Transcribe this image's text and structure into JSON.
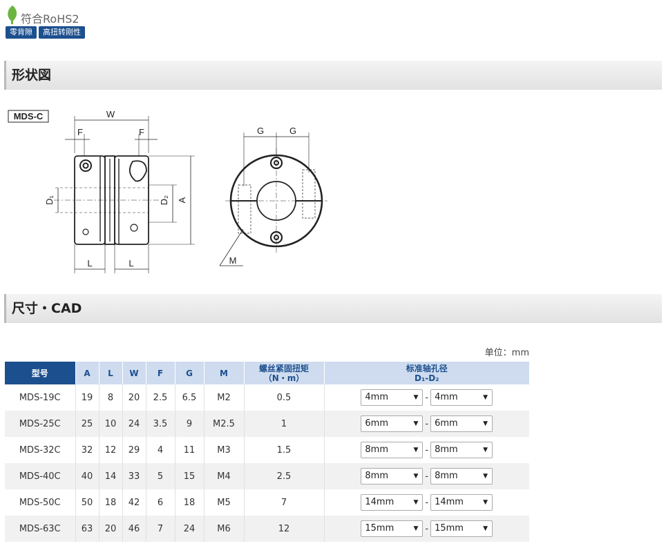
{
  "badges": {
    "rohs": "符合RoHS2",
    "tags": [
      "零背隙",
      "高扭转刚性"
    ]
  },
  "sections": {
    "shape": "形状図",
    "dimensions": "尺寸・CAD"
  },
  "drawing": {
    "model_label": "MDS-C",
    "labels": {
      "W": "W",
      "F": "F",
      "G": "G",
      "A": "A",
      "L": "L",
      "M": "M",
      "D1": "D₁",
      "D2": "D₂"
    }
  },
  "table": {
    "unit": "单位：mm",
    "headers": {
      "model": "型号",
      "A": "A",
      "L": "L",
      "W": "W",
      "F": "F",
      "G": "G",
      "M": "M",
      "torque_line1": "螺丝紧固扭矩",
      "torque_line2": "（N・m）",
      "bore_line1": "标准轴孔径",
      "bore_line2": "D₁-D₂"
    },
    "rows": [
      {
        "model": "MDS-19C",
        "A": "19",
        "L": "8",
        "W": "20",
        "F": "2.5",
        "G": "6.5",
        "M": "M2",
        "torque": "0.5",
        "d1": "4mm",
        "d2": "4mm"
      },
      {
        "model": "MDS-25C",
        "A": "25",
        "L": "10",
        "W": "24",
        "F": "3.5",
        "G": "9",
        "M": "M2.5",
        "torque": "1",
        "d1": "6mm",
        "d2": "6mm"
      },
      {
        "model": "MDS-32C",
        "A": "32",
        "L": "12",
        "W": "29",
        "F": "4",
        "G": "11",
        "M": "M3",
        "torque": "1.5",
        "d1": "8mm",
        "d2": "8mm"
      },
      {
        "model": "MDS-40C",
        "A": "40",
        "L": "14",
        "W": "33",
        "F": "5",
        "G": "15",
        "M": "M4",
        "torque": "2.5",
        "d1": "8mm",
        "d2": "8mm"
      },
      {
        "model": "MDS-50C",
        "A": "50",
        "L": "18",
        "W": "42",
        "F": "6",
        "G": "18",
        "M": "M5",
        "torque": "7",
        "d1": "14mm",
        "d2": "14mm"
      },
      {
        "model": "MDS-63C",
        "A": "63",
        "L": "20",
        "W": "46",
        "F": "7",
        "G": "24",
        "M": "M6",
        "torque": "12",
        "d1": "15mm",
        "d2": "15mm"
      }
    ],
    "dash": "-"
  },
  "colors": {
    "accent": "#1c4f8e",
    "header_light": "#cfdcef",
    "leaf": "#6cb43f"
  }
}
